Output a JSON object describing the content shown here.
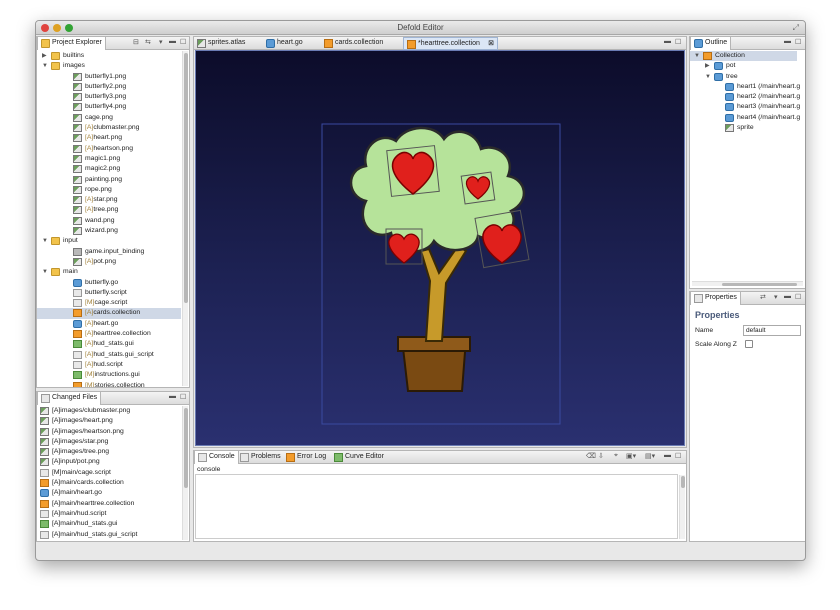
{
  "window": {
    "title": "Defold Editor"
  },
  "project_explorer": {
    "tab_label": "Project Explorer",
    "items": [
      {
        "label": "builtins",
        "type": "folder",
        "depth": 0,
        "twisty": "▶"
      },
      {
        "label": "images",
        "type": "folder",
        "depth": 0,
        "twisty": "▼"
      },
      {
        "label": "butterfly1.png",
        "type": "img",
        "depth": 2
      },
      {
        "label": "butterfly2.png",
        "type": "img",
        "depth": 2
      },
      {
        "label": "butterfly3.png",
        "type": "img",
        "depth": 2
      },
      {
        "label": "butterfly4.png",
        "type": "img",
        "depth": 2
      },
      {
        "label": "cage.png",
        "type": "img",
        "depth": 2
      },
      {
        "prefix": "[A]",
        "label": "clubmaster.png",
        "type": "img",
        "depth": 2
      },
      {
        "prefix": "[A]",
        "label": "heart.png",
        "type": "img",
        "depth": 2
      },
      {
        "prefix": "[A]",
        "label": "heartson.png",
        "type": "img",
        "depth": 2
      },
      {
        "label": "magic1.png",
        "type": "img",
        "depth": 2
      },
      {
        "label": "magic2.png",
        "type": "img",
        "depth": 2
      },
      {
        "label": "painting.png",
        "type": "img",
        "depth": 2
      },
      {
        "label": "rope.png",
        "type": "img",
        "depth": 2
      },
      {
        "prefix": "[A]",
        "label": "star.png",
        "type": "img",
        "depth": 2
      },
      {
        "prefix": "[A]",
        "label": "tree.png",
        "type": "img",
        "depth": 2
      },
      {
        "label": "wand.png",
        "type": "img",
        "depth": 2
      },
      {
        "label": "wizard.png",
        "type": "img",
        "depth": 2
      },
      {
        "label": "input",
        "type": "folder",
        "depth": 0,
        "twisty": "▼"
      },
      {
        "label": "game.input_binding",
        "type": "bind",
        "depth": 2
      },
      {
        "prefix": "[A]",
        "label": "pot.png",
        "type": "img",
        "depth": 2
      },
      {
        "label": "main",
        "type": "folder",
        "depth": 0,
        "twisty": "▼"
      },
      {
        "label": "butterfly.go",
        "type": "goi",
        "depth": 2
      },
      {
        "label": "butterfly.script",
        "type": "scr",
        "depth": 2
      },
      {
        "prefix": "[M]",
        "label": "cage.script",
        "type": "scr",
        "depth": 2
      },
      {
        "prefix": "[A]",
        "label": "cards.collection",
        "type": "coll",
        "depth": 2,
        "selected": true
      },
      {
        "prefix": "[A]",
        "label": "heart.go",
        "type": "goi",
        "depth": 2
      },
      {
        "prefix": "[A]",
        "label": "hearttree.collection",
        "type": "coll",
        "depth": 2
      },
      {
        "prefix": "[A]",
        "label": "hud_stats.gui",
        "type": "gui",
        "depth": 2
      },
      {
        "prefix": "[A]",
        "label": "hud_stats.gui_script",
        "type": "scr",
        "depth": 2
      },
      {
        "prefix": "[A]",
        "label": "hud.script",
        "type": "scr",
        "depth": 2
      },
      {
        "prefix": "[M]",
        "label": "instructions.gui",
        "type": "gui",
        "depth": 2
      },
      {
        "prefix": "[M]",
        "label": "stories.collection",
        "type": "coll",
        "depth": 2
      }
    ]
  },
  "changed_files": {
    "tab_label": "Changed Files",
    "items": [
      {
        "label": "[A]images/clubmaster.png",
        "type": "img"
      },
      {
        "label": "[A]images/heart.png",
        "type": "img"
      },
      {
        "label": "[A]images/heartson.png",
        "type": "img"
      },
      {
        "label": "[A]images/star.png",
        "type": "img"
      },
      {
        "label": "[A]images/tree.png",
        "type": "img"
      },
      {
        "label": "[A]input/pot.png",
        "type": "img"
      },
      {
        "label": "[M]main/cage.script",
        "type": "scr"
      },
      {
        "label": "[A]main/cards.collection",
        "type": "coll"
      },
      {
        "label": "[A]main/heart.go",
        "type": "goi"
      },
      {
        "label": "[A]main/hearttree.collection",
        "type": "coll"
      },
      {
        "label": "[A]main/hud.script",
        "type": "scr"
      },
      {
        "label": "[A]main/hud_stats.gui",
        "type": "gui"
      },
      {
        "label": "[A]main/hud_stats.gui_script",
        "type": "scr"
      }
    ]
  },
  "editor_tabs": [
    {
      "label": "sprites.atlas",
      "icon": "atlas-icon"
    },
    {
      "label": "heart.go",
      "icon": "gameobject-icon"
    },
    {
      "label": "cards.collection",
      "icon": "collection-icon"
    },
    {
      "label": "*hearttree.collection",
      "icon": "collection-icon",
      "active": true,
      "close": "⊠"
    }
  ],
  "outline": {
    "tab_label": "Outline",
    "items": [
      {
        "label": "Collection",
        "type": "coll",
        "depth": 0,
        "twisty": "▼",
        "selected": true
      },
      {
        "label": "pot",
        "type": "goi",
        "depth": 1,
        "twisty": "▶"
      },
      {
        "label": "tree",
        "type": "goi",
        "depth": 1,
        "twisty": "▼"
      },
      {
        "label": "heart1 (/main/heart.g",
        "type": "goi",
        "depth": 2
      },
      {
        "label": "heart2 (/main/heart.g",
        "type": "goi",
        "depth": 2
      },
      {
        "label": "heart3 (/main/heart.g",
        "type": "goi",
        "depth": 2
      },
      {
        "label": "heart4 (/main/heart.g",
        "type": "goi",
        "depth": 2
      },
      {
        "label": "sprite",
        "type": "img",
        "depth": 2
      }
    ]
  },
  "properties": {
    "tab_label": "Properties",
    "heading": "Properties",
    "name_label": "Name",
    "name_value": "default",
    "scale_label": "Scale Along Z"
  },
  "bottom_tabs": [
    {
      "label": "Console",
      "active": true
    },
    {
      "label": "Problems"
    },
    {
      "label": "Error Log"
    },
    {
      "label": "Curve Editor"
    }
  ],
  "console": {
    "text": "console"
  }
}
